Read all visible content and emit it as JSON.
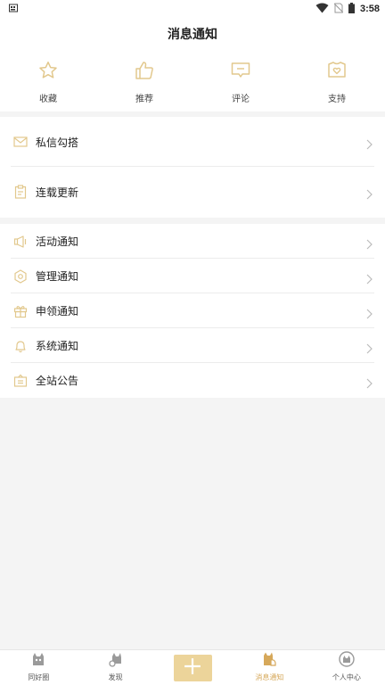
{
  "status_bar": {
    "left_icon": "sim-icon",
    "time": "3:58"
  },
  "header": {
    "title": "消息通知"
  },
  "quick_actions": [
    {
      "label": "收藏",
      "icon": "star-icon"
    },
    {
      "label": "推荐",
      "icon": "thumbs-up-icon"
    },
    {
      "label": "评论",
      "icon": "comment-icon"
    },
    {
      "label": "支持",
      "icon": "heart-badge-icon"
    }
  ],
  "primary_list": [
    {
      "label": "私信勾搭",
      "icon": "mail-icon"
    },
    {
      "label": "连载更新",
      "icon": "clipboard-icon"
    }
  ],
  "notice_list": [
    {
      "label": "活动通知",
      "icon": "megaphone-icon"
    },
    {
      "label": "管理通知",
      "icon": "hexagon-icon"
    },
    {
      "label": "申领通知",
      "icon": "gift-icon"
    },
    {
      "label": "系统通知",
      "icon": "bell-icon"
    },
    {
      "label": "全站公告",
      "icon": "notice-board-icon"
    }
  ],
  "tab_bar": {
    "items": [
      {
        "label": "同好圈",
        "icon": "circle-cat-icon"
      },
      {
        "label": "发现",
        "icon": "discover-cat-icon"
      },
      {
        "label": "",
        "icon": "plus-icon"
      },
      {
        "label": "消息通知",
        "icon": "message-cat-icon"
      },
      {
        "label": "个人中心",
        "icon": "profile-cat-icon"
      }
    ],
    "active_index": 3
  },
  "colors": {
    "accent": "#e2c88d",
    "active_tab": "#d6a85a",
    "background": "#f4f4f4",
    "add_button": "#ecd49a"
  }
}
